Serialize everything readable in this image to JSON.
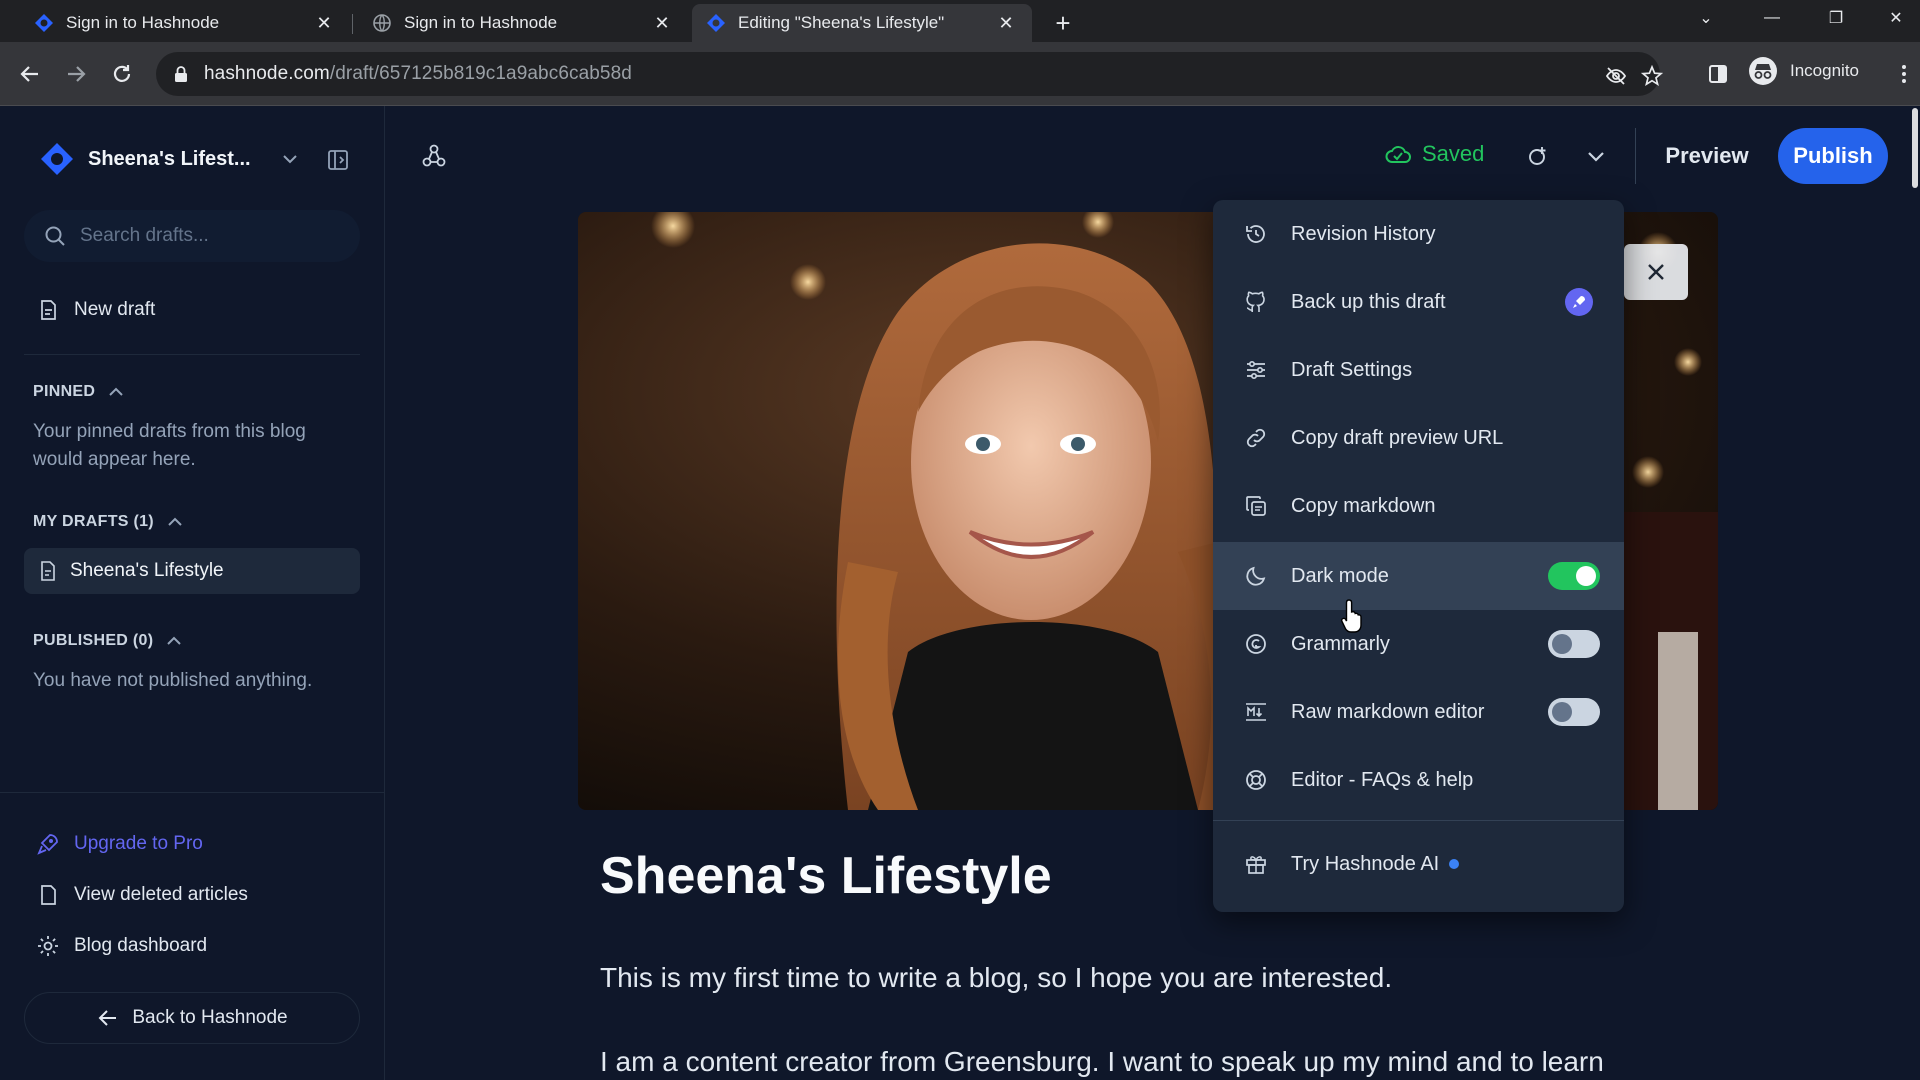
{
  "browser": {
    "tabs": [
      {
        "title": "Sign in to Hashnode",
        "active": false
      },
      {
        "title": "Sign in to Hashnode",
        "active": false
      },
      {
        "title": "Editing \"Sheena's Lifestyle\"",
        "active": true
      }
    ],
    "url_domain": "hashnode.com",
    "url_path": "/draft/657125b819c1a9abc6cab58d",
    "profile_label": "Incognito"
  },
  "sidebar": {
    "blog_name": "Sheena's Lifest...",
    "search_placeholder": "Search drafts...",
    "new_draft": "New draft",
    "pinned_header": "PINNED",
    "pinned_text": "Your pinned drafts from this blog would appear here.",
    "my_drafts_header": "MY DRAFTS (1)",
    "drafts": [
      "Sheena's Lifestyle"
    ],
    "published_header": "PUBLISHED (0)",
    "published_text": "You have not published anything.",
    "upgrade": "Upgrade to Pro",
    "view_deleted": "View deleted articles",
    "blog_dashboard": "Blog dashboard",
    "back": "Back to Hashnode"
  },
  "editor": {
    "saved_label": "Saved",
    "preview_label": "Preview",
    "publish_label": "Publish",
    "post_title": "Sheena's Lifestyle",
    "paragraph_1": "This is my first time to write a blog, so I hope you are interested.",
    "paragraph_2": "I am a content creator from Greensburg. I want to speak up my mind and to learn"
  },
  "menu": {
    "items": [
      {
        "label": "Revision History",
        "icon": "history-icon"
      },
      {
        "label": "Back up this draft",
        "icon": "github-icon",
        "badge": "rocket-icon"
      },
      {
        "label": "Draft Settings",
        "icon": "sliders-icon"
      },
      {
        "label": "Copy draft preview URL",
        "icon": "link-icon"
      },
      {
        "label": "Copy markdown",
        "icon": "copy-icon"
      },
      {
        "label": "Dark mode",
        "icon": "moon-icon",
        "toggle": true
      },
      {
        "label": "Grammarly",
        "icon": "grammarly-icon",
        "toggle": false
      },
      {
        "label": "Raw markdown editor",
        "icon": "markdown-icon",
        "toggle": false
      },
      {
        "label": "Editor - FAQs & help",
        "icon": "help-icon"
      },
      {
        "label": "Try Hashnode AI",
        "icon": "gift-icon"
      }
    ]
  },
  "colors": {
    "accent": "#2563eb",
    "saved": "#22c55e",
    "toggle_on": "#22c55e",
    "upgrade": "#6366f1"
  }
}
